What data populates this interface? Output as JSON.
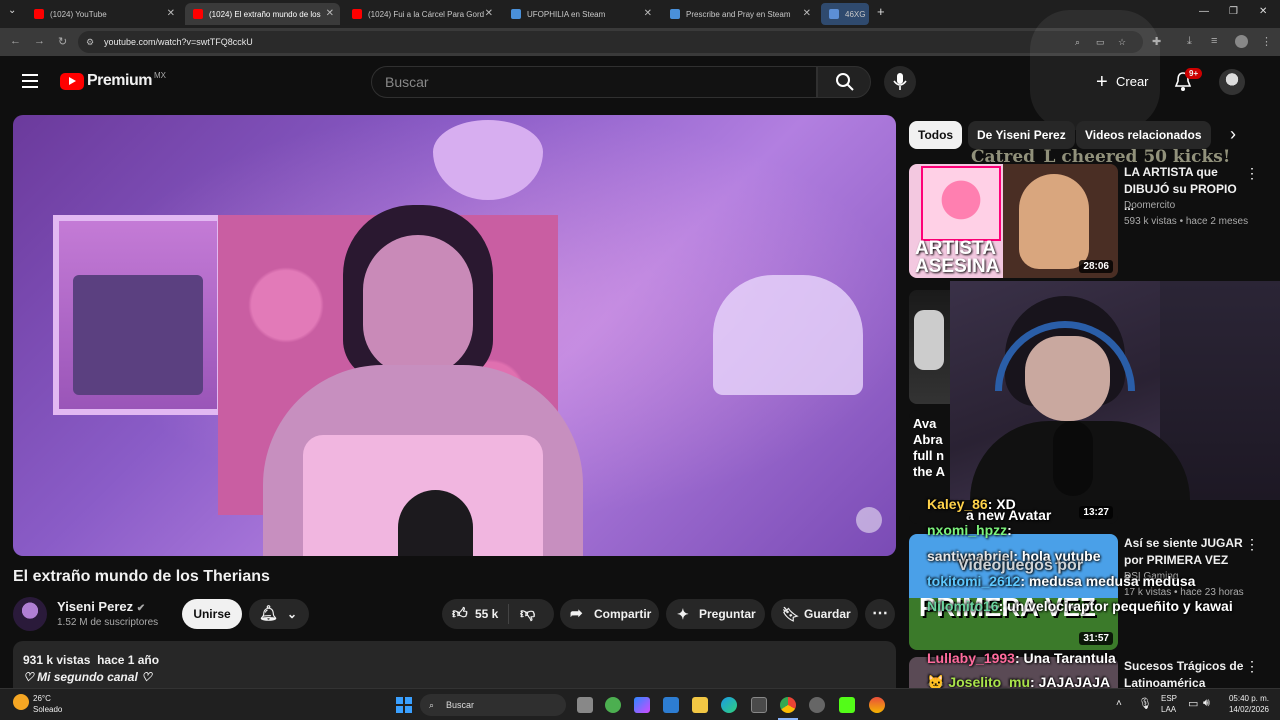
{
  "browser": {
    "tabs": [
      {
        "label": "(1024) YouTube",
        "color": "#ff0000"
      },
      {
        "label": "(1024) El extraño mundo de los",
        "color": "#ff0000"
      },
      {
        "label": "(1024) Fui a la Cárcel Para Gord",
        "color": "#ff0000"
      },
      {
        "label": "UFOPHILIA en Steam",
        "color": "#4a90d9"
      },
      {
        "label": "Prescribe and Pray en Steam",
        "color": "#4a90d9"
      },
      {
        "label": "46XG",
        "color": "#5c8fd6"
      }
    ],
    "url": "youtube.com/watch?v=swtTFQ8cckU"
  },
  "header": {
    "logo_text": "Premium",
    "region": "MX",
    "search_placeholder": "Buscar",
    "create_label": "Crear",
    "notif_badge": "9+"
  },
  "chips": [
    {
      "label": "Todos"
    },
    {
      "label": "De Yiseni Perez"
    },
    {
      "label": "Videos relacionados"
    }
  ],
  "stream_overlay": {
    "cheer_text": "Catred_L cheered 50 kicks!"
  },
  "recommendations": [
    {
      "title": "LA ARTISTA que DIBUJÓ su PROPIO ...",
      "channel": "Doomercito",
      "meta": "593 k vistas • hace 2 meses",
      "duration": "28:06",
      "thumb_text": "ARTISTA ASESINA"
    },
    {
      "duration": "",
      "thumb_text": ""
    },
    {
      "duration": "13:27",
      "thumb_text": "Ava Abra full n the A"
    },
    {
      "title": "Así se siente JUGAR por PRIMERA VEZ e...",
      "channel": "DSI Gaming",
      "meta": "17 k vistas • hace 23 horas",
      "duration": "31:57",
      "thumb_text": "PRIMERA VEZ"
    },
    {
      "title": "Sucesos Trágicos de Latinoamérica",
      "duration": ""
    }
  ],
  "chat": [
    {
      "user": "Kaley_86",
      "msg": ": XD"
    },
    {
      "user": "",
      "msg": "a new Avatar"
    },
    {
      "user": "nxomi_hpzz",
      "msg": ":"
    },
    {
      "user": "santiynabriel",
      "msg": ": hola yutube"
    },
    {
      "user": "",
      "msg": "Videojuegos por"
    },
    {
      "user": "tokitomi_2612",
      "msg": ": medusa medusa medusa"
    },
    {
      "user": "Nilomito16",
      "msg": ": un velociraptor pequeñito y kawai"
    },
    {
      "user": "Lullaby_1993",
      "msg": ": Una Tarantula"
    },
    {
      "user": "Joselito_mu",
      "msg": ": JAJAJAJA"
    }
  ],
  "video": {
    "title": "El extraño mundo de los Therians",
    "channel": "Yiseni Perez",
    "subs": "1.52 M de suscriptores",
    "join_label": "Unirse",
    "likes": "55 k",
    "share_label": "Compartir",
    "ask_label": "Preguntar",
    "save_label": "Guardar",
    "views": "931 k vistas",
    "date": "hace 1 año",
    "desc_line": "♡ Mi segundo canal ♡"
  },
  "taskbar": {
    "weather_temp": "26°C",
    "weather_text": "Soleado",
    "search_label": "Buscar",
    "lang": "ESP",
    "lang2": "LAA",
    "time": "05:40 p. m.",
    "date": "14/02/2026"
  },
  "colors": {
    "accent": "#ff0000",
    "bg": "#0f0f0f"
  }
}
